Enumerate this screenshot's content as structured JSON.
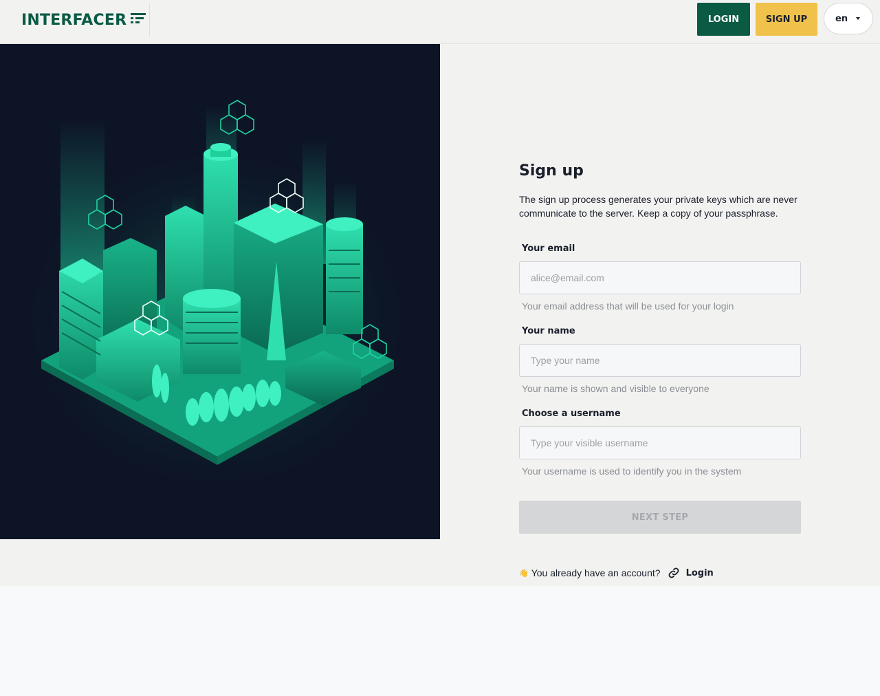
{
  "header": {
    "logo_text": "INTERFACER",
    "login_label": "LOGIN",
    "signup_label": "SIGN UP",
    "language": "en"
  },
  "illustration": {
    "name": "isometric-green-city"
  },
  "form": {
    "title": "Sign up",
    "intro": "The sign up process generates your private keys which are never communicate to the server. Keep a copy of your passphrase.",
    "email": {
      "label": "Your email",
      "placeholder": "alice@email.com",
      "help": "Your email address that will be used for your login"
    },
    "name": {
      "label": "Your name",
      "placeholder": "Type your name",
      "help": "Your name is shown and visible to everyone"
    },
    "username": {
      "label": "Choose a username",
      "placeholder": "Type your visible username",
      "help": "Your username is used to identify you in the system"
    },
    "next_label": "NEXT STEP",
    "account_prompt": "You already have an account?",
    "login_link": "Login"
  },
  "colors": {
    "brand_green": "#0a5a44",
    "accent_yellow": "#f0c24b",
    "illustration_bg": "#0d1426",
    "city_green": "#14b88a"
  }
}
